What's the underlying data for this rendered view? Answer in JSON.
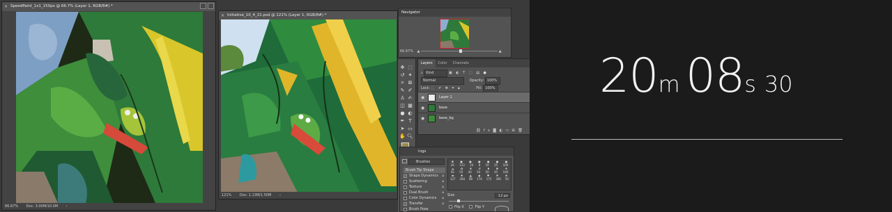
{
  "doc1": {
    "title": "SpeedPaint_1x1_150px @ 66.7% (Layer 1, RGB/8#) *",
    "zoom": "66.67%",
    "doc_size": "Doc: 3.00M/10.0M"
  },
  "doc2": {
    "title": "Initiative_10_4_21.psd @ 121% (Layer 1, RGB/8#) *",
    "zoom": "121%",
    "doc_size": "Doc: 1.13M/1.50M"
  },
  "navigator": {
    "title": "Navigator",
    "zoom": "66.67%"
  },
  "layers_panel": {
    "tabs": [
      "Layers",
      "Color",
      "Channels"
    ],
    "kind_label": "Kind",
    "blend_mode": "Normal",
    "opacity_label": "Opacity:",
    "opacity_value": "100%",
    "lock_label": "Lock:",
    "fill_label": "Fill:",
    "fill_value": "100%",
    "layers": [
      {
        "name": "Layer 1"
      },
      {
        "name": "base"
      },
      {
        "name": "base_bg"
      }
    ]
  },
  "brush_panel": {
    "title": "ings",
    "brushes_button": "Brushes",
    "items": [
      {
        "label": "Brush Tip Shape",
        "checked": false
      },
      {
        "label": "Shape Dynamics",
        "checked": true
      },
      {
        "label": "Scattering",
        "checked": false
      },
      {
        "label": "Texture",
        "checked": false
      },
      {
        "label": "Dual Brush",
        "checked": false
      },
      {
        "label": "Color Dynamics",
        "checked": false
      },
      {
        "label": "Transfer",
        "checked": true
      },
      {
        "label": "Brush Pose",
        "checked": false
      }
    ],
    "sizes_row1": [
      "26",
      "123",
      "24",
      "8",
      "10",
      "25",
      "100"
    ],
    "sizes_row2": [
      "56",
      "50",
      "40",
      "50",
      "50",
      "45",
      "100"
    ],
    "sizes_row3": [
      "127",
      "284",
      "80",
      "174",
      "175",
      "306",
      "50"
    ],
    "size_label": "Size",
    "size_value": "12 px",
    "flip_x": "Flip X",
    "flip_y": "Flip Y"
  },
  "timer": {
    "minutes": "20",
    "minutes_unit": "m",
    "seconds": "08",
    "seconds_unit": "s",
    "hundredths": "30"
  }
}
